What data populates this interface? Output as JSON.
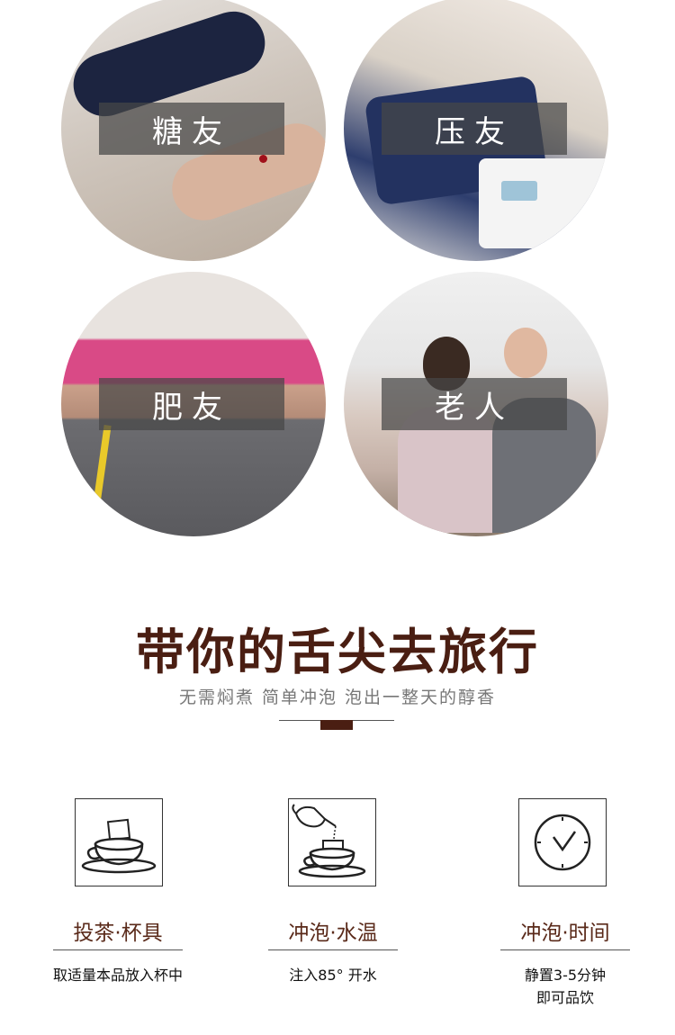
{
  "audience": [
    {
      "label": "糖友"
    },
    {
      "label": "压友"
    },
    {
      "label": "肥友"
    },
    {
      "label": "老人"
    }
  ],
  "heading": "带你的舌尖去旅行",
  "subheading": "无需焖煮 简单冲泡 泡出一整天的醇香",
  "steps": [
    {
      "title": "投茶·杯具",
      "desc": "取适量本品放入杯中",
      "icon": "tea-cup-icon"
    },
    {
      "title": "冲泡·水温",
      "desc": "注入85° 开水",
      "icon": "teapot-pour-icon"
    },
    {
      "title": "冲泡·时间",
      "desc_line1": "静置3-5分钟",
      "desc_line2": "即可品饮",
      "icon": "clock-icon"
    }
  ],
  "colors": {
    "accent": "#4a1e12",
    "label_overlay": "rgba(70,70,70,0.72)"
  }
}
